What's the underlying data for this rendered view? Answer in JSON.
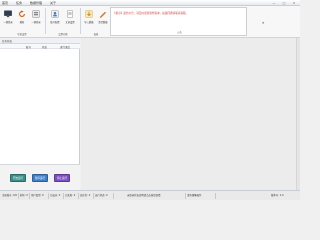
{
  "menu": [
    "首页",
    "任务",
    "数据管理",
    "关于"
  ],
  "window_controls": [
    "—",
    "□",
    "✕"
  ],
  "toolbar": {
    "group1": {
      "label": "导航设置",
      "buttons": [
        {
          "label": "一键登录",
          "icon": "monitor-icon"
        },
        {
          "label": "刷新",
          "icon": "refresh-icon"
        },
        {
          "label": "一键登录",
          "icon": "login-icon"
        }
      ]
    },
    "group2": {
      "label": "设置功能",
      "buttons": [
        {
          "label": "账号配置",
          "icon": "user-settings-icon"
        },
        {
          "label": "文章设置",
          "icon": "document-icon"
        }
      ]
    },
    "group3": {
      "label": "面板",
      "buttons": [
        {
          "label": "导入数据",
          "icon": "import-icon"
        },
        {
          "label": "清空数据",
          "icon": "pencil-icon"
        }
      ]
    },
    "marquee": {
      "text": "【提示】最新公告：请及时更新软件版本，如遇问题请联系客服。",
      "label": "公告"
    },
    "expand": "»"
  },
  "left_panel": {
    "section": "任务状态",
    "columns": [
      "账号",
      "状态",
      "进行进度"
    ],
    "buttons": [
      {
        "label": "开始运行",
        "color": "#3a8f86"
      },
      {
        "label": "暂停运行",
        "color": "#3f7fc9"
      },
      {
        "label": "停止运行",
        "color": "#7a4fc0"
      }
    ]
  },
  "statusbar": {
    "items": [
      "当前账号: 0/0",
      "剩余: 0",
      "用户类型: 0",
      "已成功: 0",
      "已失败: 0",
      "总任务: 0",
      "运行状态: 0",
      "未登录状态说明请点击按钮查看",
      "请勿频繁操作",
      "版本号: 1.0"
    ]
  },
  "colors": {
    "accent": "#3f7fc9",
    "notice": "#d13b3b"
  }
}
